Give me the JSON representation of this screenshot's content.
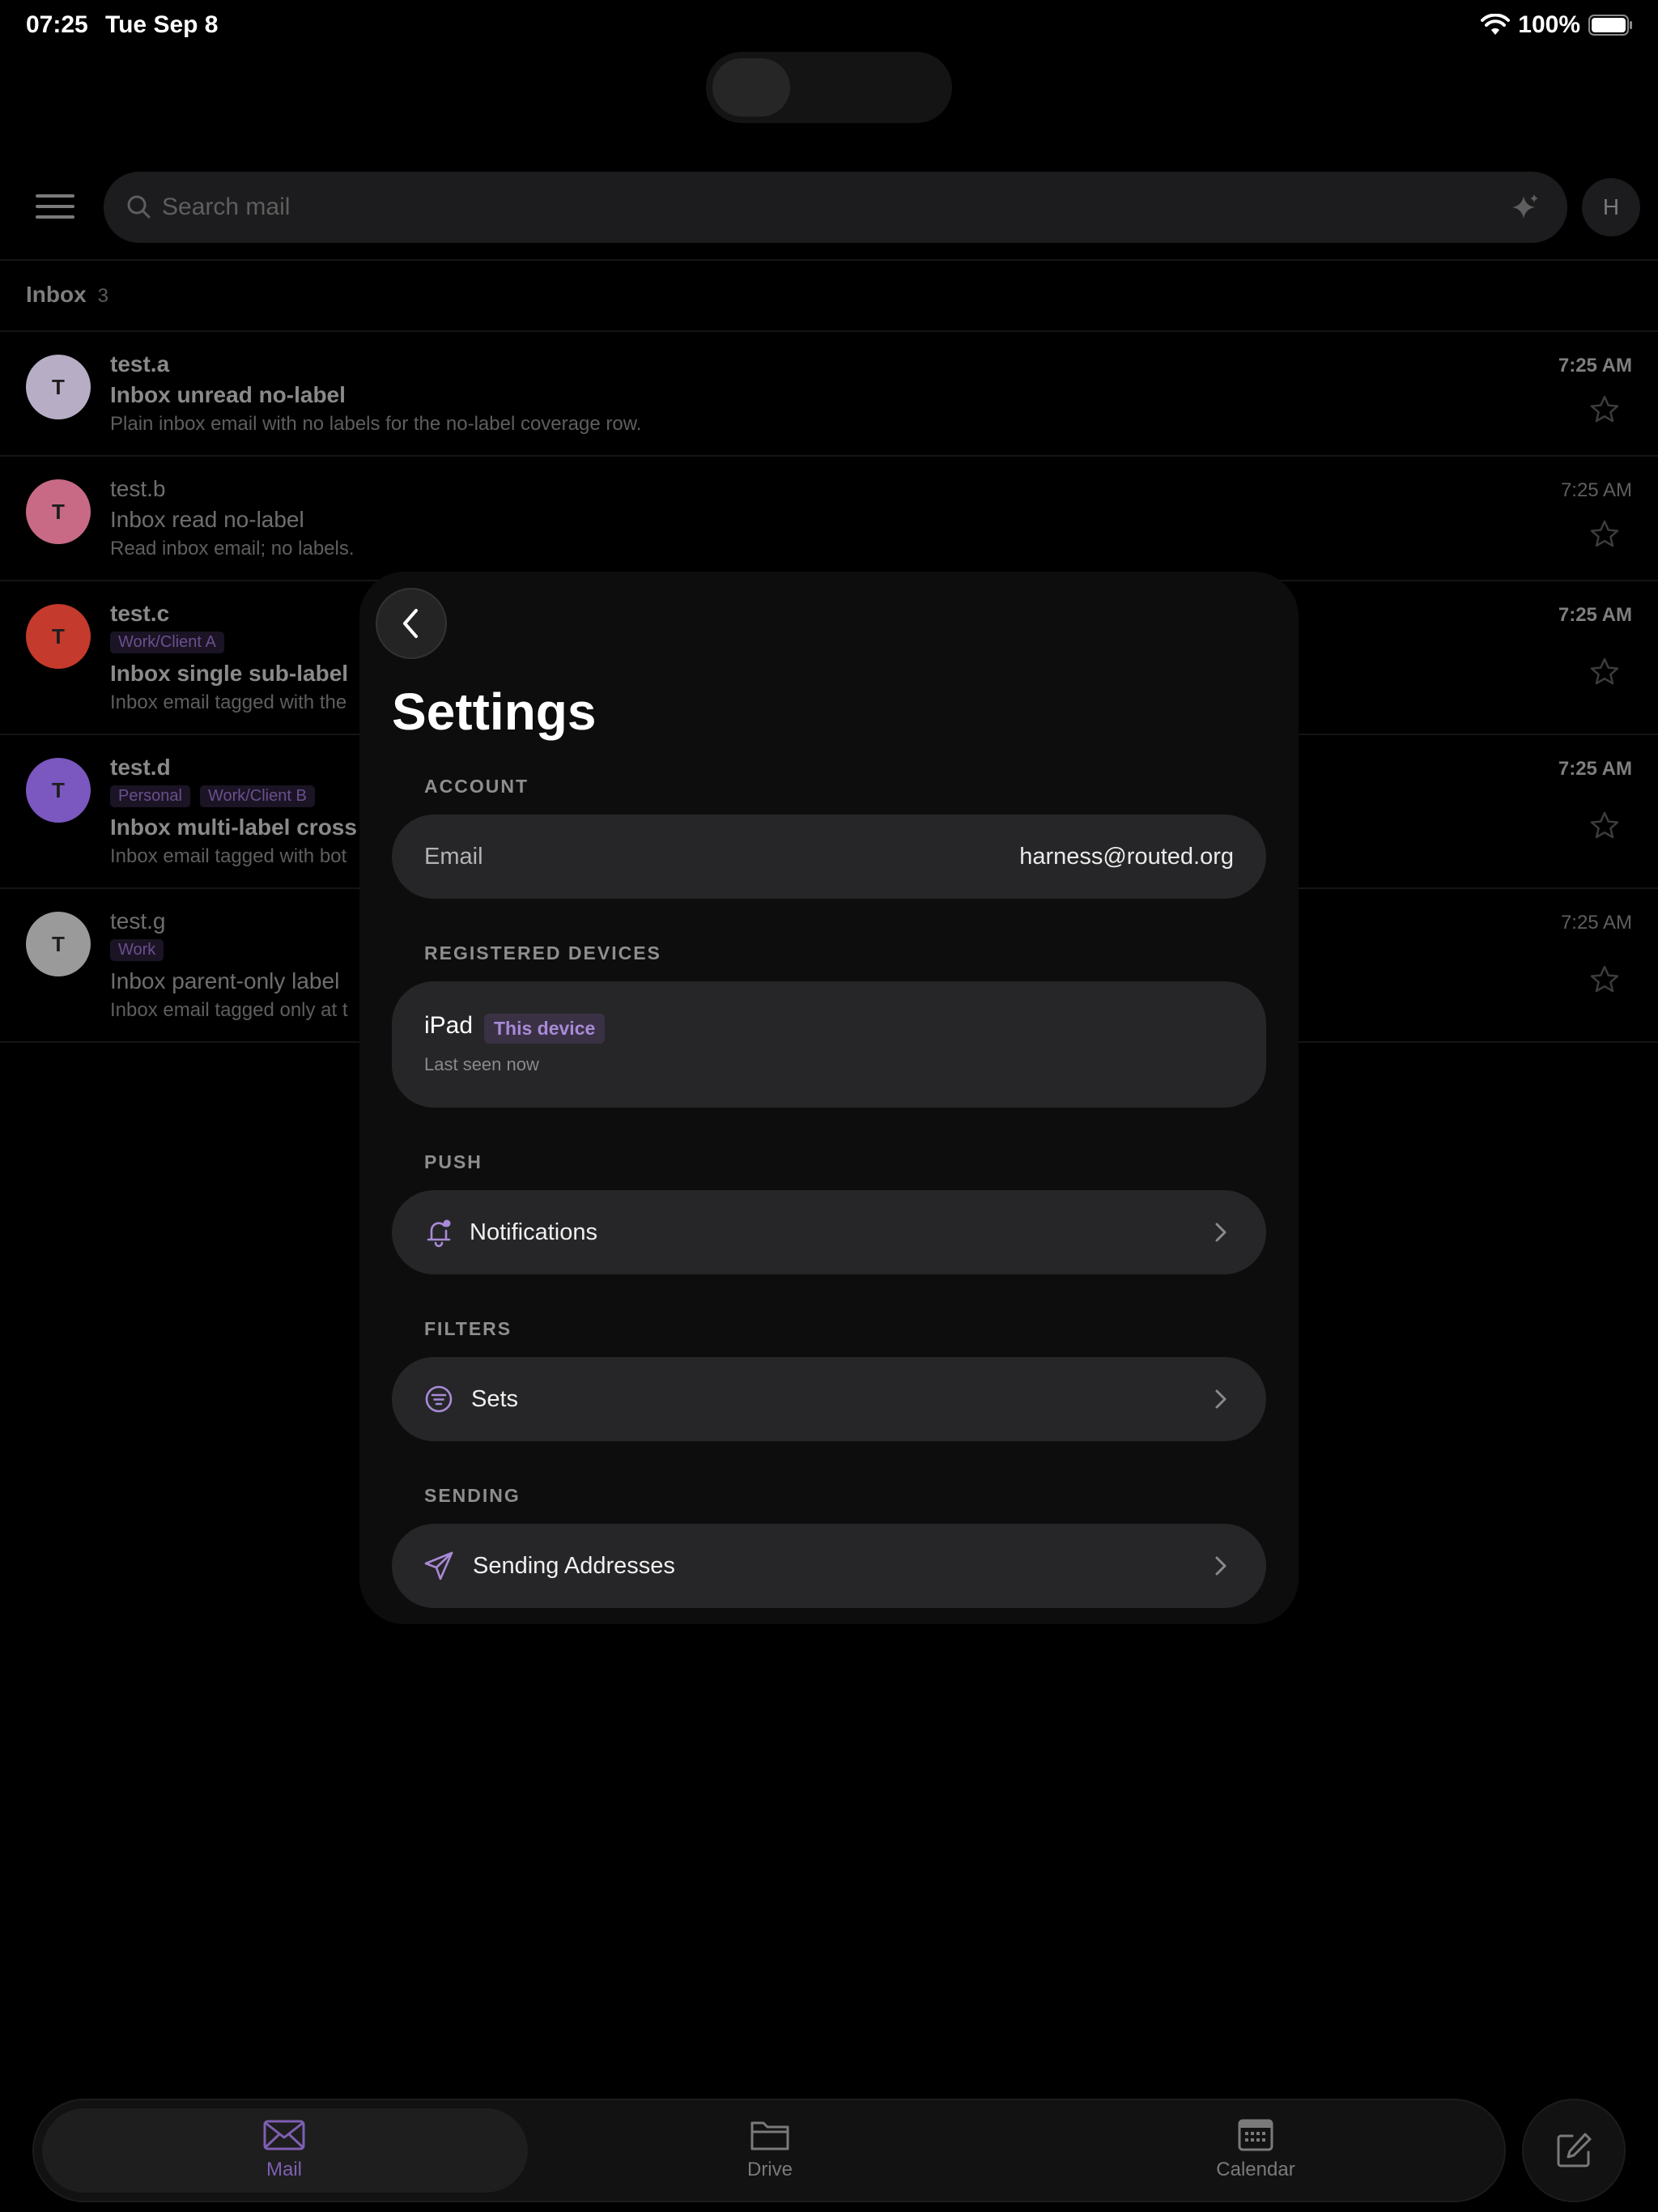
{
  "status_bar": {
    "time": "07:25",
    "date": "Tue Sep 8",
    "battery": "100%",
    "wifi_icon": "wifi-icon",
    "battery_icon": "battery-icon"
  },
  "search": {
    "placeholder": "Search mail",
    "avatar_initial": "H"
  },
  "inbox": {
    "title": "Inbox",
    "count": "3",
    "emails": [
      {
        "avatar": "T",
        "avatar_color": "#b7aec6",
        "sender": "test.a",
        "subject": "Inbox unread no-label",
        "snippet": "Plain inbox email with no labels for the no-label coverage row.",
        "time": "7:25 AM",
        "unread": true,
        "labels": []
      },
      {
        "avatar": "T",
        "avatar_color": "#c86a86",
        "sender": "test.b",
        "subject": "Inbox read no-label",
        "snippet": "Read inbox email; no labels.",
        "time": "7:25 AM",
        "unread": false,
        "labels": []
      },
      {
        "avatar": "T",
        "avatar_color": "#c43a2c",
        "sender": "test.c",
        "subject": "Inbox single sub-label",
        "snippet": "Inbox email tagged with the",
        "time": "7:25 AM",
        "unread": true,
        "labels": [
          "Work/Client A"
        ]
      },
      {
        "avatar": "T",
        "avatar_color": "#7b57c0",
        "sender": "test.d",
        "subject": "Inbox multi-label cross",
        "snippet": "Inbox email tagged with bot",
        "time": "7:25 AM",
        "unread": true,
        "labels": [
          "Personal",
          "Work/Client B"
        ]
      },
      {
        "avatar": "T",
        "avatar_color": "#9a9a9a",
        "sender": "test.g",
        "subject": "Inbox parent-only label",
        "snippet": "Inbox email tagged only at t",
        "time": "7:25 AM",
        "unread": false,
        "labels": [
          "Work"
        ]
      }
    ]
  },
  "settings": {
    "title": "Settings",
    "account_section": "ACCOUNT",
    "email_label": "Email",
    "email_value": "harness@routed.org",
    "devices_section": "REGISTERED DEVICES",
    "device_name": "iPad",
    "device_badge": "This device",
    "device_seen": "Last seen now",
    "push_section": "PUSH",
    "notifications_label": "Notifications",
    "filters_section": "FILTERS",
    "sets_label": "Sets",
    "sending_section": "SENDING",
    "sending_addresses_label": "Sending Addresses",
    "accent_color": "#a98ad6"
  },
  "tabbar": {
    "mail": "Mail",
    "drive": "Drive",
    "calendar": "Calendar",
    "active": "Mail"
  }
}
